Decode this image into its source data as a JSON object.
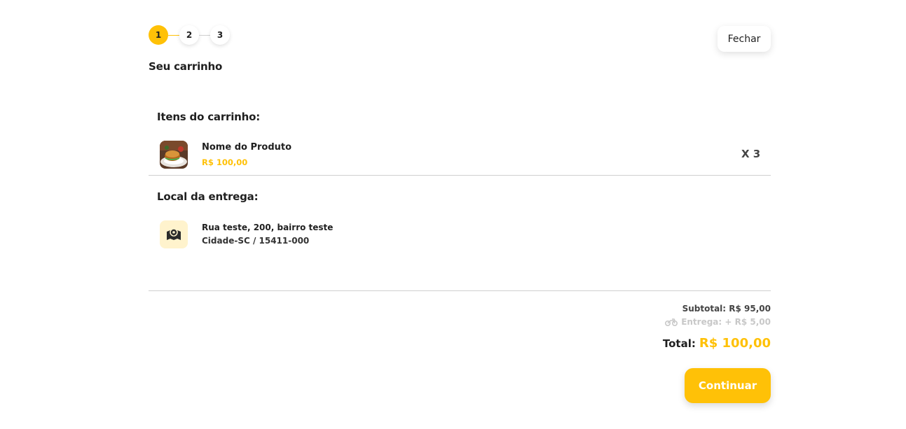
{
  "stepper": {
    "steps": [
      "1",
      "2",
      "3"
    ],
    "active_step": 1
  },
  "header": {
    "close_label": "Fechar",
    "title": "Seu carrinho"
  },
  "cart": {
    "section_title": "Itens do carrinho:",
    "items": [
      {
        "name": "Nome do Produto",
        "price": "R$ 100,00",
        "quantity": "X 3"
      }
    ]
  },
  "delivery": {
    "section_title": "Local da entrega:",
    "address_line1": "Rua teste, 200, bairro teste",
    "address_line2": "Cidade-SC / 15411-000",
    "icon": "map-marker-icon"
  },
  "summary": {
    "subtotal": "Subtotal: R$ 95,00",
    "delivery_fee": "Entrega: + R$ 5,00",
    "delivery_icon": "motorcycle-icon",
    "total_label": "Total:",
    "total_value": "R$ 100,00"
  },
  "actions": {
    "continue_label": "Continuar"
  },
  "colors": {
    "accent": "#FFC107",
    "accent_light": "#FFF3CD",
    "text": "#1f1f1f",
    "muted": "#c8c8c8"
  }
}
